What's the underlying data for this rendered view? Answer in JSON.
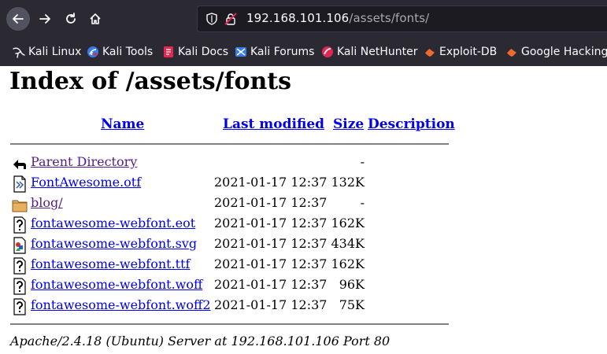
{
  "browser": {
    "url_host": "192.168.101.106",
    "url_path": "/assets/fonts/"
  },
  "bookmarks": [
    {
      "label": "Kali Linux",
      "icon": "kali-dragon-icon"
    },
    {
      "label": "Kali Tools",
      "icon": "kali-tools-icon"
    },
    {
      "label": "Kali Docs",
      "icon": "kali-docs-icon"
    },
    {
      "label": "Kali Forums",
      "icon": "kali-forums-icon"
    },
    {
      "label": "Kali NetHunter",
      "icon": "kali-nethunter-icon"
    },
    {
      "label": "Exploit-DB",
      "icon": "exploit-db-icon"
    },
    {
      "label": "Google Hacking",
      "icon": "google-hacking-icon"
    }
  ],
  "page": {
    "title": "Index of /assets/fonts",
    "headers": {
      "name": "Name",
      "last_modified": "Last modified",
      "size": "Size",
      "description": "Description"
    },
    "rows": [
      {
        "name": "Parent Directory",
        "date": "",
        "size": "-",
        "icon": "back-arrow-icon"
      },
      {
        "name": "FontAwesome.otf",
        "date": "2021-01-17 12:37",
        "size": "132K",
        "icon": "file-icon"
      },
      {
        "name": "blog/",
        "date": "2021-01-17 12:37",
        "size": "-",
        "icon": "folder-icon"
      },
      {
        "name": "fontawesome-webfont.eot",
        "date": "2021-01-17 12:37",
        "size": "162K",
        "icon": "unknown-file-icon"
      },
      {
        "name": "fontawesome-webfont.svg",
        "date": "2021-01-17 12:37",
        "size": "434K",
        "icon": "image-file-icon"
      },
      {
        "name": "fontawesome-webfont.ttf",
        "date": "2021-01-17 12:37",
        "size": "162K",
        "icon": "unknown-file-icon"
      },
      {
        "name": "fontawesome-webfont.woff",
        "date": "2021-01-17 12:37",
        "size": "96K",
        "icon": "unknown-file-icon"
      },
      {
        "name": "fontawesome-webfont.woff2",
        "date": "2021-01-17 12:37",
        "size": "75K",
        "icon": "unknown-file-icon"
      }
    ],
    "footer": "Apache/2.4.18 (Ubuntu) Server at 192.168.101.106 Port 80"
  },
  "colors": {
    "chrome_bg": "#2b2a33",
    "link": "#0000ee",
    "visited_link": "#551a8b"
  }
}
